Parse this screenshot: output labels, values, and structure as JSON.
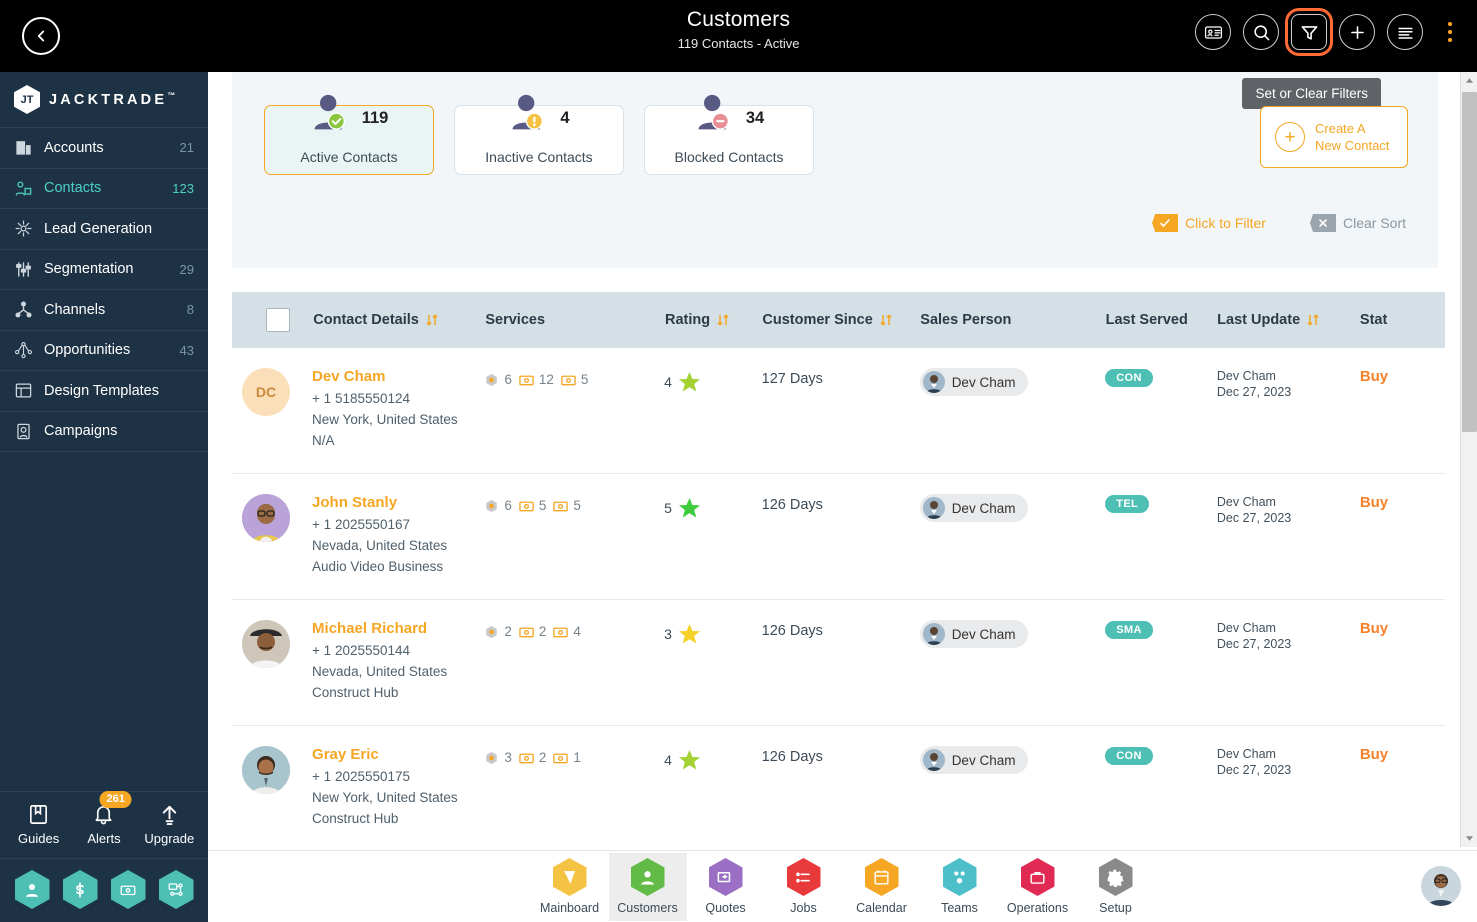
{
  "header": {
    "back_icon": "chevron-left-icon",
    "title": "Customers",
    "subtitle": "119 Contacts - Active",
    "actions": [
      {
        "name": "contact-card-icon",
        "label": "Contact Card"
      },
      {
        "name": "search-icon",
        "label": "Search"
      },
      {
        "name": "filter-icon",
        "label": "Filter",
        "highlighted": true
      },
      {
        "name": "add-icon",
        "label": "Add"
      },
      {
        "name": "list-icon",
        "label": "List View"
      }
    ],
    "menu_icon": "kebab-menu-icon",
    "highlight_color": "#ff6b35"
  },
  "tooltip": {
    "text": "Set or Clear Filters"
  },
  "sidebar": {
    "brand": {
      "name": "JACKTRADE",
      "tm": "™",
      "mark": "JT"
    },
    "items": [
      {
        "label": "Accounts",
        "count": "21",
        "icon": "building-icon",
        "active": false
      },
      {
        "label": "Contacts",
        "count": "123",
        "icon": "contacts-icon",
        "active": true
      },
      {
        "label": "Lead Generation",
        "count": "",
        "icon": "lead-generation-icon",
        "active": false
      },
      {
        "label": "Segmentation",
        "count": "29",
        "icon": "segmentation-icon",
        "active": false
      },
      {
        "label": "Channels",
        "count": "8",
        "icon": "channels-icon",
        "active": false
      },
      {
        "label": "Opportunities",
        "count": "43",
        "icon": "opportunities-icon",
        "active": false
      },
      {
        "label": "Design Templates",
        "count": "",
        "icon": "design-templates-icon",
        "active": false
      },
      {
        "label": "Campaigns",
        "count": "",
        "icon": "campaigns-icon",
        "active": false
      }
    ],
    "tools": [
      {
        "label": "Guides",
        "icon": "book-icon",
        "badge": ""
      },
      {
        "label": "Alerts",
        "icon": "bell-icon",
        "badge": "261"
      },
      {
        "label": "Upgrade",
        "icon": "upgrade-arrow-icon",
        "badge": ""
      }
    ],
    "shortcuts": [
      {
        "name": "profile-hex-icon"
      },
      {
        "name": "dollar-hex-icon"
      },
      {
        "name": "payment-hex-icon"
      },
      {
        "name": "network-hex-icon"
      }
    ],
    "accent": "#4dd0c4",
    "background": "#1e3245"
  },
  "stats": [
    {
      "count": "119",
      "label": "Active Contacts",
      "status": "check",
      "selected": true
    },
    {
      "count": "4",
      "label": "Inactive Contacts",
      "status": "warning",
      "selected": false
    },
    {
      "count": "34",
      "label": "Blocked Contacts",
      "status": "blocked",
      "selected": false
    }
  ],
  "create_button": {
    "line1": "Create A",
    "line2": "New Contact",
    "icon": "plus-circle-icon"
  },
  "filters": [
    {
      "label": "Click to Filter",
      "state": "on",
      "icon": "check-badge-icon"
    },
    {
      "label": "Clear Sort",
      "state": "off",
      "icon": "x-badge-icon"
    }
  ],
  "table": {
    "columns": [
      {
        "label": "",
        "sortable": false
      },
      {
        "label": "Contact Details",
        "sortable": true
      },
      {
        "label": "Services",
        "sortable": false
      },
      {
        "label": "Rating",
        "sortable": true
      },
      {
        "label": "Customer Since",
        "sortable": true
      },
      {
        "label": "Sales Person",
        "sortable": false
      },
      {
        "label": "Last Served",
        "sortable": false
      },
      {
        "label": "Last Update",
        "sortable": true
      },
      {
        "label": "Stat",
        "sortable": false
      }
    ],
    "rows": [
      {
        "initials": "DC",
        "avatar_type": "initials",
        "avatar_bg": "#fbdfb8",
        "name": "Dev Cham",
        "phone": "+ 1 5185550124",
        "location": "New York, United States",
        "company": "N/A",
        "services": [
          {
            "icon": "hex-badge-icon",
            "count": "6"
          },
          {
            "icon": "card-icon",
            "count": "12"
          },
          {
            "icon": "card-icon",
            "count": "5"
          }
        ],
        "rating": "4",
        "star_color": "#a4d233",
        "since": "127 Days",
        "sales_person": "Dev Cham",
        "last_served": "CON",
        "update_name": "Dev Cham",
        "update_date": "Dec 27, 2023",
        "status": "Buy"
      },
      {
        "initials": "",
        "avatar_type": "photo",
        "avatar_bg": "#b9a3d9",
        "name": "John Stanly",
        "phone": "+ 1 2025550167",
        "location": "Nevada, United States",
        "company": "Audio Video Business",
        "services": [
          {
            "icon": "hex-badge-icon",
            "count": "6"
          },
          {
            "icon": "card-icon",
            "count": "5"
          },
          {
            "icon": "card-icon",
            "count": "5"
          }
        ],
        "rating": "5",
        "star_color": "#3fcc3f",
        "since": "126 Days",
        "sales_person": "Dev Cham",
        "last_served": "TEL",
        "update_name": "Dev Cham",
        "update_date": "Dec 27, 2023",
        "status": "Buy"
      },
      {
        "initials": "",
        "avatar_type": "photo",
        "avatar_bg": "#d9cfc3",
        "name": "Michael Richard",
        "phone": "+ 1 2025550144",
        "location": "Nevada, United States",
        "company": "Construct Hub",
        "services": [
          {
            "icon": "hex-badge-icon",
            "count": "2"
          },
          {
            "icon": "card-icon",
            "count": "2"
          },
          {
            "icon": "card-icon",
            "count": "4"
          }
        ],
        "rating": "3",
        "star_color": "#f3d129",
        "since": "126 Days",
        "sales_person": "Dev Cham",
        "last_served": "SMA",
        "update_name": "Dev Cham",
        "update_date": "Dec 27, 2023",
        "status": "Buy"
      },
      {
        "initials": "",
        "avatar_type": "photo",
        "avatar_bg": "#a8c4cc",
        "name": "Gray Eric",
        "phone": "+ 1 2025550175",
        "location": "New York, United States",
        "company": "Construct Hub",
        "services": [
          {
            "icon": "hex-badge-icon",
            "count": "3"
          },
          {
            "icon": "card-icon",
            "count": "2"
          },
          {
            "icon": "card-icon",
            "count": "1"
          }
        ],
        "rating": "4",
        "star_color": "#a4d233",
        "since": "126 Days",
        "sales_person": "Dev Cham",
        "last_served": "CON",
        "update_name": "Dev Cham",
        "update_date": "Dec 27, 2023",
        "status": "Buy"
      }
    ]
  },
  "pagination": {
    "prev_icon": "chevron-left-icon",
    "next_icon": "chevron-right-icon"
  },
  "bottom_nav": [
    {
      "label": "Mainboard",
      "color": "#f5c344",
      "icon": "mainboard-icon",
      "active": false
    },
    {
      "label": "Customers",
      "color": "#62bb46",
      "icon": "customers-icon",
      "active": true
    },
    {
      "label": "Quotes",
      "color": "#9b6fc4",
      "icon": "quotes-icon",
      "active": false
    },
    {
      "label": "Jobs",
      "color": "#e8393b",
      "icon": "jobs-icon",
      "active": false
    },
    {
      "label": "Calendar",
      "color": "#f5a623",
      "icon": "calendar-icon",
      "active": false
    },
    {
      "label": "Teams",
      "color": "#4dbfc9",
      "icon": "teams-icon",
      "active": false
    },
    {
      "label": "Operations",
      "color": "#e02a54",
      "icon": "operations-icon",
      "active": false
    },
    {
      "label": "Setup",
      "color": "#8a8a8a",
      "icon": "setup-gear-icon",
      "active": false
    }
  ],
  "user_avatar": {
    "name": "user-avatar"
  }
}
